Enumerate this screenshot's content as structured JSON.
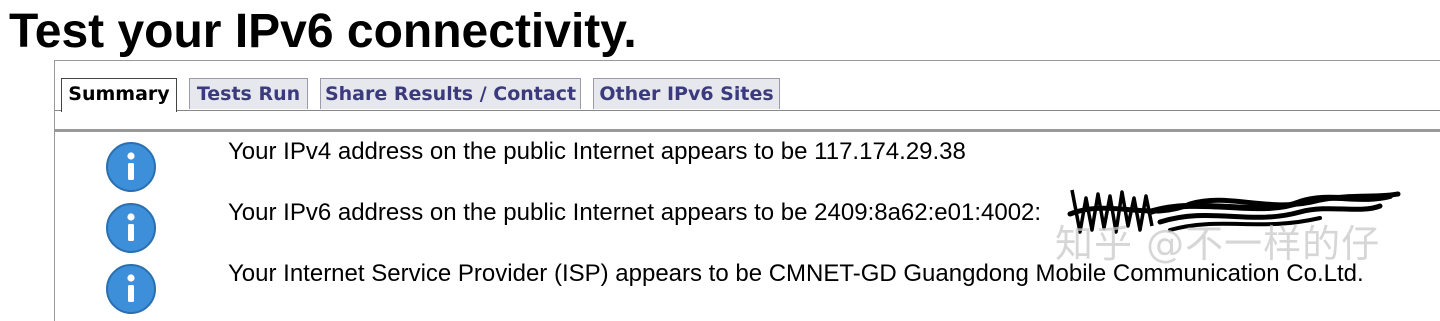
{
  "page": {
    "title": "Test your IPv6 connectivity."
  },
  "tabs": [
    {
      "label": "Summary",
      "active": true
    },
    {
      "label": "Tests Run",
      "active": false
    },
    {
      "label": "Share Results / Contact",
      "active": false
    },
    {
      "label": "Other IPv6 Sites",
      "active": false
    }
  ],
  "results": [
    {
      "icon": "info-icon",
      "text": "Your IPv4 address on the public Internet appears to be 117.174.29.38"
    },
    {
      "icon": "info-icon",
      "text": "Your IPv6 address on the public Internet appears to be 2409:8a62:e01:4002:"
    },
    {
      "icon": "info-icon",
      "text": "Your Internet Service Provider (ISP) appears to be CMNET-GD Guangdong Mobile Communication Co.Ltd."
    }
  ],
  "watermark": {
    "text": "知乎 @不一样的仔"
  },
  "colors": {
    "icon_blue": "#3d8fd9",
    "tab_text": "#3a3a7c",
    "tab_bg": "#e7e7ee"
  }
}
